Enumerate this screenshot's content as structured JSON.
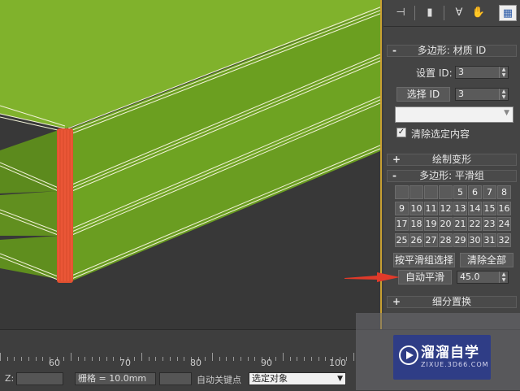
{
  "toolbar": {
    "icons": [
      "pin-stack-icon",
      "modifier-stack-icon",
      "show-end-result-icon",
      "make-unique-icon",
      "configure-modifier-sets-icon"
    ]
  },
  "editable_poly": {
    "material_id_rollout": {
      "title": "多边形: 材质 ID",
      "sign": "-",
      "set_id_label": "设置 ID:",
      "set_id_value": "3",
      "select_id_label": "选择 ID",
      "select_id_value": "3",
      "name_dropdown_value": "",
      "clear_selection_label": "清除选定内容",
      "clear_selection_checked": true
    },
    "paint_deformation_rollout": {
      "title": "绘制变形",
      "sign": "+"
    },
    "smoothing_groups_rollout": {
      "title": "多边形: 平滑组",
      "sign": "-",
      "groups": [
        "",
        "",
        "",
        "",
        "5",
        "6",
        "7",
        "8",
        "9",
        "10",
        "11",
        "12",
        "13",
        "14",
        "15",
        "16",
        "17",
        "18",
        "19",
        "20",
        "21",
        "22",
        "23",
        "24",
        "25",
        "26",
        "27",
        "28",
        "29",
        "30",
        "31",
        "32"
      ],
      "select_by_sg_label": "按平滑组选择",
      "clear_all_label": "清除全部",
      "auto_smooth_label": "自动平滑",
      "auto_smooth_value": "45.0"
    },
    "subdivision_rollout": {
      "title": "细分置换",
      "sign": "+"
    }
  },
  "timeline": {
    "tick_labels": [
      "60",
      "70",
      "80",
      "90",
      "100"
    ],
    "status_fields": {
      "prefix": "Z:",
      "grid_text": "栅格 = 10.0mm",
      "autokey_text": "自动关键点",
      "selection_dropdown": "选定对象"
    }
  },
  "watermark": {
    "brand_cn": "溜溜自学",
    "brand_url": "ZIXUE.3D66.COM"
  },
  "colors": {
    "viewport_bg": "#383838",
    "slab_top": "#7fb02c",
    "slab_side": "#5c8a1d",
    "selected_edge": "#e05030",
    "annotation_arrow": "#e03a2a",
    "active_viewport_border": "#c8a032"
  }
}
